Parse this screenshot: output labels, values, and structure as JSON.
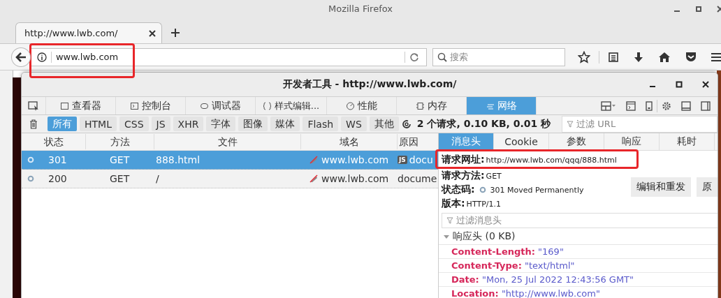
{
  "window": {
    "title": "Mozilla Firefox"
  },
  "tabs": [
    {
      "title": "http://www.lwb.com/",
      "selected": true
    }
  ],
  "address_bar": {
    "value": "www.lwb.com"
  },
  "search": {
    "placeholder": "搜索"
  },
  "devtools": {
    "title": "开发者工具 - http://www.lwb.com/",
    "tools": [
      {
        "label": "查看器",
        "selected": false
      },
      {
        "label": "控制台",
        "selected": false
      },
      {
        "label": "调试器",
        "selected": false
      },
      {
        "label": "样式编辑...",
        "selected": false
      },
      {
        "label": "性能",
        "selected": false
      },
      {
        "label": "内存",
        "selected": false
      },
      {
        "label": "网络",
        "selected": true
      }
    ],
    "filters": [
      {
        "label": "所有",
        "selected": true
      },
      {
        "label": "HTML",
        "selected": false
      },
      {
        "label": "CSS",
        "selected": false
      },
      {
        "label": "JS",
        "selected": false
      },
      {
        "label": "XHR",
        "selected": false
      },
      {
        "label": "字体",
        "selected": false
      },
      {
        "label": "图像",
        "selected": false
      },
      {
        "label": "媒体",
        "selected": false
      },
      {
        "label": "Flash",
        "selected": false
      },
      {
        "label": "WS",
        "selected": false
      },
      {
        "label": "其他",
        "selected": false
      }
    ],
    "summary": "2 个请求, 0.10 KB, 0.01 秒",
    "url_filter": {
      "placeholder": "过滤 URL"
    },
    "columns": [
      "状态",
      "方法",
      "文件",
      "域名",
      "原因"
    ],
    "requests": [
      {
        "status": "301",
        "method": "GET",
        "file": "888.html",
        "domain": "www.lwb.com",
        "cause_badge": "JS",
        "cause": "docu",
        "selected": true
      },
      {
        "status": "200",
        "method": "GET",
        "file": "/",
        "domain": "www.lwb.com",
        "cause": "docume",
        "selected": false
      }
    ],
    "details": {
      "tabs": [
        {
          "label": "消息头",
          "selected": true
        },
        {
          "label": "Cookie",
          "selected": false
        },
        {
          "label": "参数",
          "selected": false
        },
        {
          "label": "响应",
          "selected": false
        },
        {
          "label": "耗时",
          "selected": false
        }
      ],
      "fields": [
        {
          "kind": "text",
          "label": "请求网址:",
          "value": "http://www.lwb.com/qqq/888.html"
        },
        {
          "kind": "text",
          "label": "请求方法:",
          "value": "GET"
        },
        {
          "kind": "status",
          "label": "状态码:",
          "value": "301 Moved Permanently"
        },
        {
          "kind": "text",
          "label": "版本:",
          "value": "HTTP/1.1"
        }
      ],
      "buttons": [
        "编辑和重发",
        "原"
      ],
      "header_filter": {
        "placeholder": "过滤消息头"
      },
      "section": {
        "title": "响应头 (0 KB)",
        "expanded": true
      },
      "headers": [
        {
          "name": "Content-Length:",
          "value": "\"169\""
        },
        {
          "name": "Content-Type:",
          "value": "\"text/html\""
        },
        {
          "name": "Date:",
          "value": "\"Mon, 25 Jul 2022 12:43:56 GMT\""
        },
        {
          "name": "Location:",
          "value": "\"http://www.lwb.com\""
        }
      ]
    }
  }
}
